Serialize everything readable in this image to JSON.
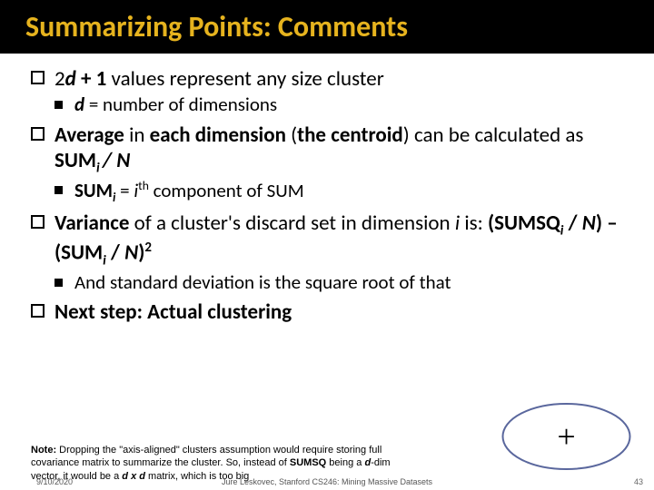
{
  "title": "Summarizing Points: Comments",
  "bullets": {
    "b1": {
      "pre": "2",
      "d": "d",
      "plus1": " + 1",
      "rest": " values represent any size cluster"
    },
    "b1a": {
      "d": "d",
      "rest": "  = number of dimensions"
    },
    "b2": {
      "avg": "Average",
      "mid": " in ",
      "each": "each dimension",
      "open": " (",
      "centroid": "the centroid",
      "close": ") can be calculated as ",
      "sumi": "SUM",
      "sub": "i ",
      "slashN": "/ N"
    },
    "b2a": {
      "sumi": "SUM",
      "sub": "i",
      "eq": " = ",
      "ith_i": "i",
      "ith_th": "th",
      "rest": " component of SUM"
    },
    "b3": {
      "var": "Variance",
      "mid": " of a cluster's discard set in dimension ",
      "i": "i",
      "is": " is: ",
      "open1": "(SUMSQ",
      "sub1": "i",
      "slashN1": " / ",
      "N1": "N",
      "close1": ") – (SUM",
      "sub2": "i",
      "slashN2": " / ",
      "N2": "N",
      "close2": ")",
      "sq": "2"
    },
    "b3a": "And standard deviation is the square root of that",
    "b4": "Next step: Actual clustering"
  },
  "note": {
    "label": "Note:",
    "t1": " Dropping the \"axis-aligned\" clusters assumption would require storing full covariance matrix to summarize the cluster. So, instead of ",
    "sumsq": "SUMSQ",
    "t2": " being a ",
    "d1": "d",
    "t3": "-dim vector, it would be a ",
    "d2": "d",
    "x": " x ",
    "d3": "d",
    "t4": " matrix, which is too big",
    "cutoff": "!"
  },
  "footer": {
    "date": "9/10/2020",
    "center": "Jure Leskovec, Stanford CS246: Mining Massive Datasets",
    "page": "43"
  },
  "decor": {
    "plus": "+"
  }
}
